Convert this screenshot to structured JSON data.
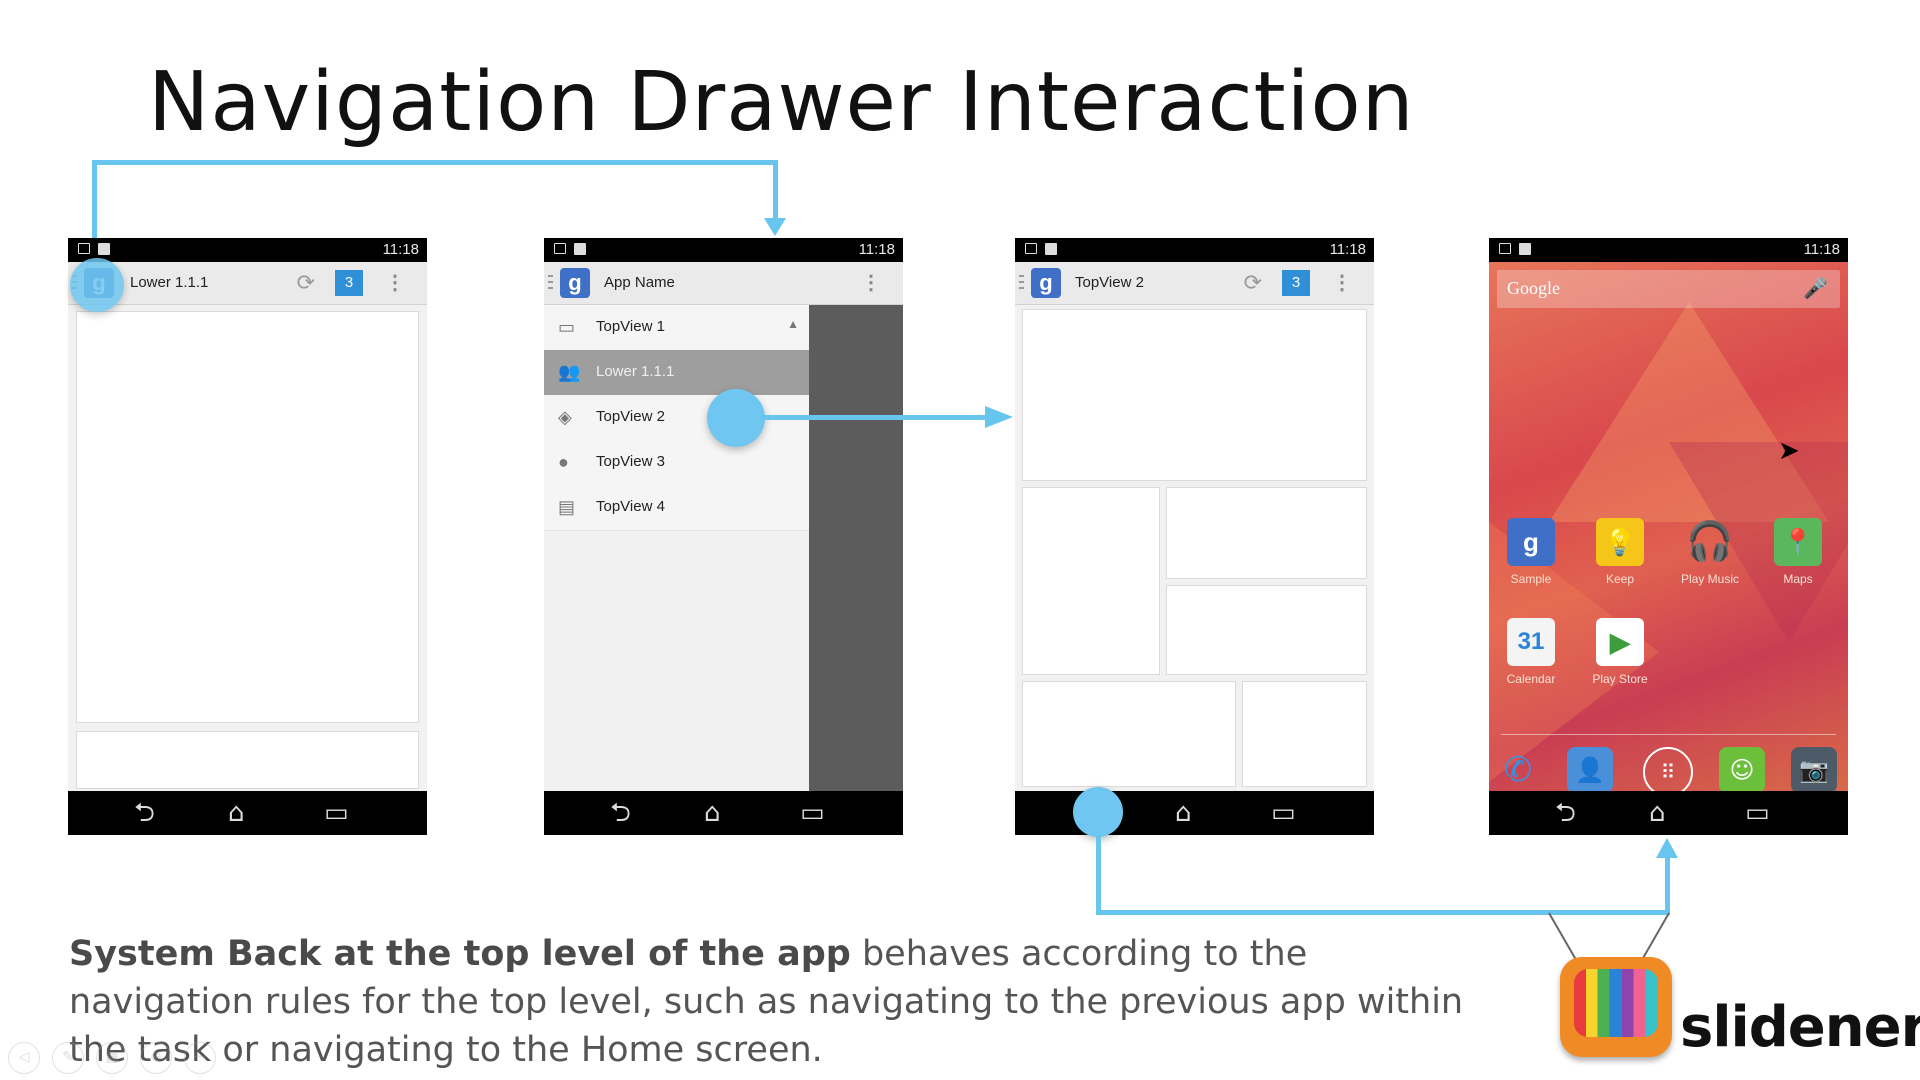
{
  "slide": {
    "title": "Navigation Drawer Interaction",
    "caption_bold": "System Back at the top level of the app",
    "caption_rest": " behaves according to the navigation rules for the top level, such as navigating to the previous app within the task or navigating to the Home screen."
  },
  "status_time": "11:18",
  "screen1": {
    "title": "Lower 1.1.1",
    "badge": "3"
  },
  "screen2": {
    "title": "App Name",
    "drawer_items": [
      {
        "label": "TopView 1",
        "icon": "inbox-icon"
      },
      {
        "label": "Lower 1.1.1",
        "icon": "people-icon"
      },
      {
        "label": "TopView 2",
        "icon": "tag-icon"
      },
      {
        "label": "TopView 3",
        "icon": "info-icon"
      },
      {
        "label": "TopView 4",
        "icon": "chat-icon"
      }
    ]
  },
  "screen3": {
    "title": "TopView 2",
    "badge": "3"
  },
  "screen4": {
    "search_label": "Google",
    "apps": [
      {
        "label": "Sample",
        "color": "#3f6fc7"
      },
      {
        "label": "Keep",
        "color": "#f5c518"
      },
      {
        "label": "Play Music",
        "color": "#f08a24"
      },
      {
        "label": "Maps",
        "color": "#5bb75b"
      },
      {
        "label": "Calendar",
        "color": "#2a83d8"
      },
      {
        "label": "Play Store",
        "color": "#ffffff"
      }
    ],
    "dock": [
      "phone-icon",
      "contacts-icon",
      "app-drawer-icon",
      "messaging-icon",
      "camera-icon"
    ]
  },
  "logo": {
    "word": "slidenerd"
  },
  "colors": {
    "accent": "#67c5ee",
    "badge": "#2f8fd7"
  }
}
